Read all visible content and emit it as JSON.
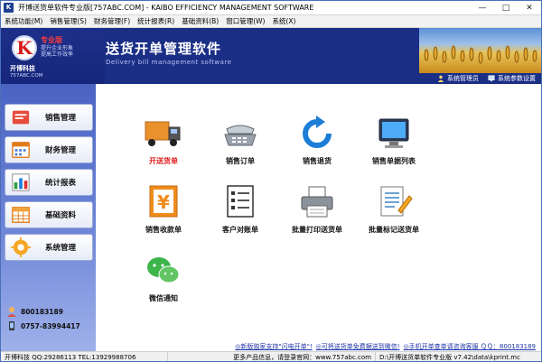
{
  "window": {
    "title": "开博送货单软件专业版[757ABC.COM] - KAIBO EFFICIENCY MANAGEMENT SOFTWARE",
    "app_icon": "K"
  },
  "menubar": {
    "items": [
      {
        "label": "系统功能(M)"
      },
      {
        "label": "销售管理(S)"
      },
      {
        "label": "财务管理(F)"
      },
      {
        "label": "统计报表(R)"
      },
      {
        "label": "基础资料(B)"
      },
      {
        "label": "窗口管理(W)"
      },
      {
        "label": "系统(X)"
      }
    ]
  },
  "banner": {
    "logo_letter": "K",
    "pro_badge": "专业版",
    "slogan_line1": "提升企业形象",
    "slogan_line2": "提高工作效率",
    "company": "开博科技",
    "company_url": "757ABC.COM",
    "title": "送货开单管理软件",
    "subtitle": "Delivery bill management software",
    "user_admin": "系统管理员",
    "settings": "系统参数设置"
  },
  "sidebar": {
    "items": [
      {
        "label": "销售管理",
        "icon": "cart-icon"
      },
      {
        "label": "财务管理",
        "icon": "calendar-icon"
      },
      {
        "label": "统计报表",
        "icon": "bar-chart-icon"
      },
      {
        "label": "基础资料",
        "icon": "table-icon"
      },
      {
        "label": "系统管理",
        "icon": "gear-icon"
      }
    ],
    "phone1": "800183189",
    "phone2": "0757-83994417"
  },
  "tiles": [
    {
      "label": "开送货单",
      "icon": "truck-icon",
      "active": true
    },
    {
      "label": "销售订单",
      "icon": "telephone-icon"
    },
    {
      "label": "销售退货",
      "icon": "refresh-arrow-icon"
    },
    {
      "label": "销售单据列表",
      "icon": "monitor-icon"
    },
    {
      "label": "销售收款单",
      "icon": "yen-receipt-icon"
    },
    {
      "label": "客户对账单",
      "icon": "checklist-icon"
    },
    {
      "label": "批量打印送货单",
      "icon": "printer-icon"
    },
    {
      "label": "批量标记送货单",
      "icon": "mark-document-icon"
    },
    {
      "label": "微信通知",
      "icon": "wechat-icon"
    }
  ],
  "ticker": {
    "link1": "◎新版独家支持\"闪电开单\"!",
    "link2": "◎可将送货单免费据送到微信!",
    "link3": "◎手机开单查单请咨询客服 ＱＱ：800183189"
  },
  "statusbar": {
    "contact": "开博科技 QQ:29286113 TEL:13929988706",
    "website": "更多产品信息，请登录官网：www.757abc.com",
    "path": "D:\\开博送货单软件专业版 v7.42\\data\\kprint.mc"
  },
  "colors": {
    "banner_bg": "#1b2e86",
    "sidebar_gradient_top": "#4a63c2",
    "active_label": "#e01b1b",
    "ticker_link": "#1e34a8"
  }
}
